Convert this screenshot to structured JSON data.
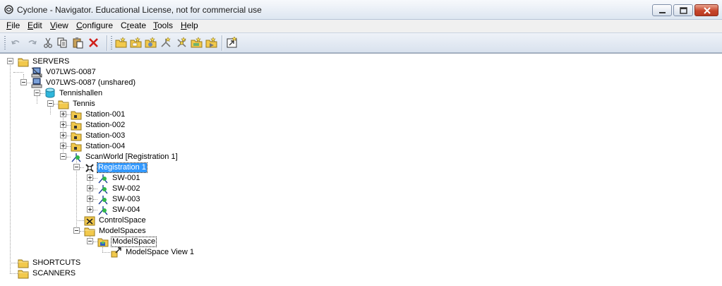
{
  "window": {
    "title": "Cyclone - Navigator. Educational License, not for commercial use"
  },
  "menu": [
    {
      "label": "File",
      "u": "F",
      "rest": "ile"
    },
    {
      "label": "Edit",
      "u": "E",
      "rest": "dit"
    },
    {
      "label": "View",
      "u": "V",
      "rest": "iew"
    },
    {
      "label": "Configure",
      "u": "C",
      "rest": "onfigure"
    },
    {
      "label": "Create",
      "u": "r",
      "pre": "C",
      "rest": "eate"
    },
    {
      "label": "Tools",
      "u": "T",
      "rest": "ools"
    },
    {
      "label": "Help",
      "u": "H",
      "rest": "elp"
    }
  ],
  "tree": {
    "servers": "SERVERS",
    "server1": "V07LWS-0087",
    "server2": "V07LWS-0087 (unshared)",
    "database": "Tennishallen",
    "project": "Tennis",
    "stations": [
      "Station-001",
      "Station-002",
      "Station-003",
      "Station-004"
    ],
    "scanworld": "ScanWorld [Registration 1]",
    "registration": "Registration 1",
    "scanworlds": [
      "SW-001",
      "SW-002",
      "SW-003",
      "SW-004"
    ],
    "controlspace": "ControlSpace",
    "modelspaces": "ModelSpaces",
    "modelspace": "ModelSpace",
    "modelspace_view": "ModelSpace  View 1",
    "shortcuts": "SHORTCUTS",
    "scanners": "SCANNERS"
  },
  "colors": {
    "selection": "#3399ff",
    "folder": "#f2c94c",
    "close_button": "#c7452b"
  }
}
